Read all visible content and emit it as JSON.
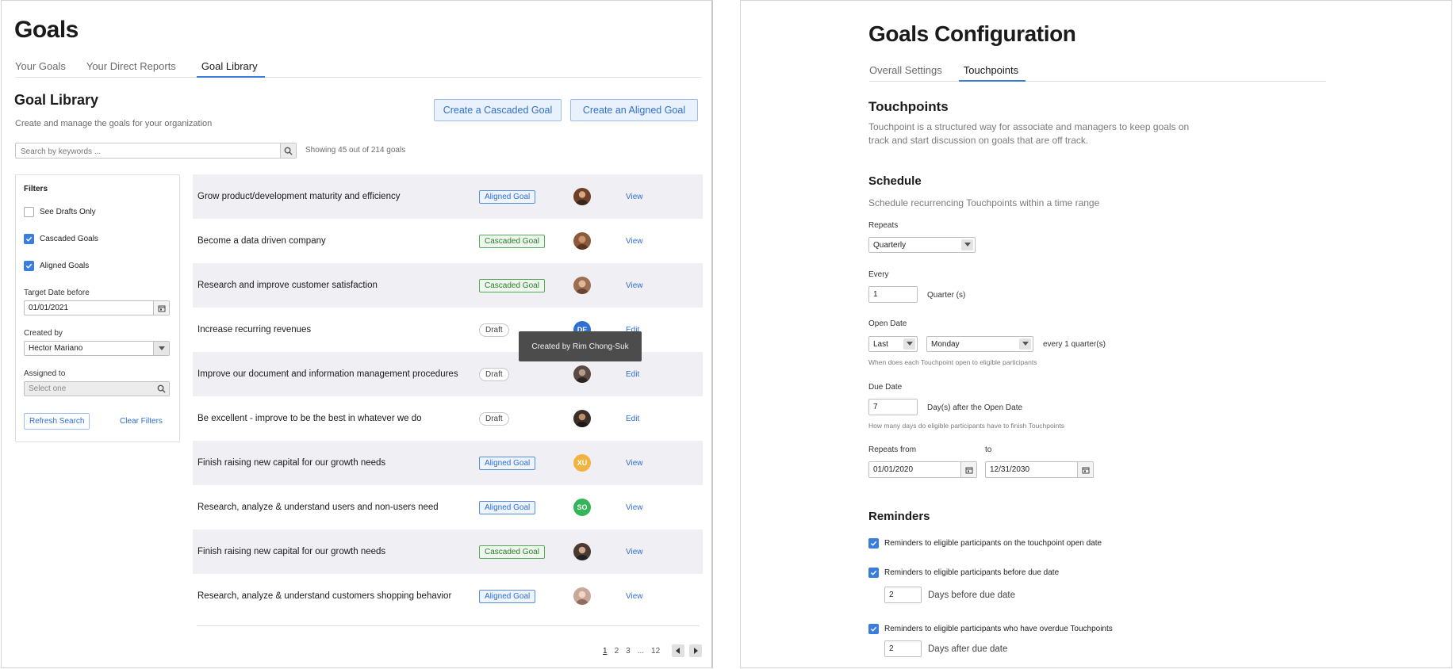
{
  "left": {
    "page_title": "Goals",
    "tabs": [
      {
        "label": "Your Goals",
        "active": false
      },
      {
        "label": "Your Direct Reports",
        "active": false
      },
      {
        "label": "Goal Library",
        "active": true
      }
    ],
    "section_title": "Goal Library",
    "section_subtitle": "Create and manage the goals for your organization",
    "buttons": {
      "create_cascaded": "Create a Cascaded Goal",
      "create_aligned": "Create an Aligned Goal"
    },
    "search": {
      "placeholder": "Search by keywords ...",
      "showing": "Showing 45 out of 214 goals"
    },
    "filters": {
      "title": "Filters",
      "checkboxes": [
        {
          "label": "See Drafts Only",
          "checked": false
        },
        {
          "label": "Cascaded Goals",
          "checked": true
        },
        {
          "label": "Aligned Goals",
          "checked": true
        }
      ],
      "target_date_label": "Target Date before",
      "target_date_value": "01/01/2021",
      "created_by_label": "Created by",
      "created_by_value": "Hector Mariano",
      "assigned_to_label": "Assigned to",
      "assigned_to_placeholder": "Select one",
      "refresh_label": "Refresh Search",
      "clear_label": "Clear Filters"
    },
    "goals": [
      {
        "title": "Grow product/development maturity and efficiency",
        "badge": "Aligned Goal",
        "badge_type": "aligned",
        "avatar": "",
        "avatar_color": "#6b3f2a",
        "action": "View"
      },
      {
        "title": "Become a data driven company",
        "badge": "Cascaded Goal",
        "badge_type": "cascaded",
        "avatar": "",
        "avatar_color": "#8a5a3b",
        "action": "View"
      },
      {
        "title": "Research and improve customer satisfaction",
        "badge": "Cascaded Goal",
        "badge_type": "cascaded",
        "avatar": "",
        "avatar_color": "#9a6f52",
        "action": "View"
      },
      {
        "title": "Increase recurring revenues",
        "badge": "Draft",
        "badge_type": "draft",
        "avatar": "DE",
        "avatar_color": "#2f6fd0",
        "action": "Edit"
      },
      {
        "title": "Improve our document and information management procedures",
        "badge": "Draft",
        "badge_type": "draft",
        "avatar": "",
        "avatar_color": "#5a4a44",
        "action": "Edit"
      },
      {
        "title": "Be excellent - improve to be the best in whatever we do",
        "badge": "Draft",
        "badge_type": "draft",
        "avatar": "",
        "avatar_color": "#3a2e28",
        "action": "Edit"
      },
      {
        "title": "Finish raising new capital for our growth needs",
        "badge": "Aligned Goal",
        "badge_type": "aligned",
        "avatar": "XU",
        "avatar_color": "#f2b440",
        "action": "View"
      },
      {
        "title": "Research, analyze & understand users and non-users need",
        "badge": "Aligned Goal",
        "badge_type": "aligned",
        "avatar": "SO",
        "avatar_color": "#34b55a",
        "action": "View"
      },
      {
        "title": "Finish raising new capital for our growth needs",
        "badge": "Cascaded Goal",
        "badge_type": "cascaded",
        "avatar": "",
        "avatar_color": "#4a3a34",
        "action": "View"
      },
      {
        "title": "Research, analyze & understand customers shopping behavior",
        "badge": "Aligned Goal",
        "badge_type": "aligned",
        "avatar": "",
        "avatar_color": "#c9a79a",
        "action": "View"
      }
    ],
    "tooltip": "Created by Rim Chong-Suk",
    "pagination": {
      "pages": [
        "1",
        "2",
        "3",
        "...",
        "12"
      ],
      "current": "1"
    }
  },
  "right": {
    "page_title": "Goals Configuration",
    "tabs": [
      {
        "label": "Overall Settings",
        "active": false
      },
      {
        "label": "Touchpoints",
        "active": true
      }
    ],
    "touchpoints_title": "Touchpoints",
    "touchpoints_desc": "Touchpoint is a structured way for associate and managers to keep goals on track and start discussion on goals that are off track.",
    "schedule_title": "Schedule",
    "schedule_desc": "Schedule recurrencing Touchpoints within a time range",
    "repeats_label": "Repeats",
    "repeats_value": "Quarterly",
    "every_label": "Every",
    "every_value": "1",
    "every_unit": "Quarter (s)",
    "open_date_label": "Open Date",
    "open_date_when": "Last",
    "open_date_day": "Monday",
    "open_date_suffix": "every 1 quarter(s)",
    "open_date_help": "When does each Touchpoint open to eligible participants",
    "due_date_label": "Due Date",
    "due_date_value": "7",
    "due_date_suffix": "Day(s) after the Open Date",
    "due_date_help": "How many days do eligible participants have to finish Touchpoints",
    "repeats_from_label": "Repeats from",
    "repeats_to_label": "to",
    "repeats_from_value": "01/01/2020",
    "repeats_to_value": "12/31/2030",
    "reminders_title": "Reminders",
    "reminders": [
      {
        "label": "Reminders to eligible participants on the touchpoint open date",
        "checked": true
      },
      {
        "label": "Reminders to eligible participants before due date",
        "checked": true,
        "days": "2",
        "days_label": "Days before due date"
      },
      {
        "label": "Reminders to eligible participants who have overdue Touchpoints",
        "checked": true,
        "days": "2",
        "days_label": "Days after due date"
      }
    ]
  }
}
